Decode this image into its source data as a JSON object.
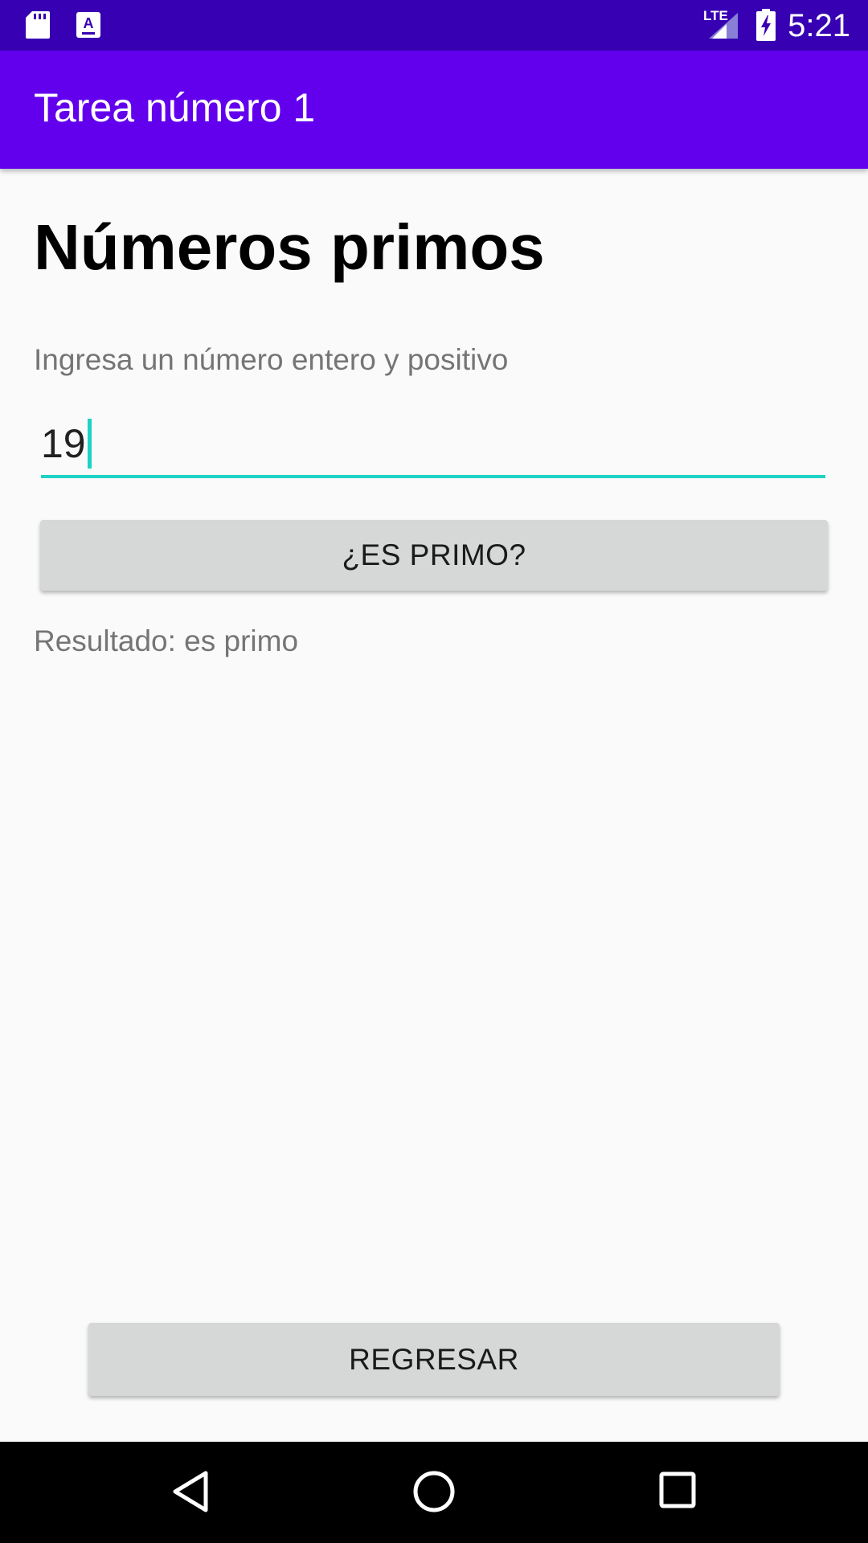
{
  "status_bar": {
    "time": "5:21",
    "network_label": "LTE",
    "left_icons": [
      "sd-card-icon",
      "keyboard-a-icon"
    ],
    "right_icons": [
      "signal-icon",
      "battery-charging-icon"
    ]
  },
  "app_bar": {
    "title": "Tarea número 1"
  },
  "main": {
    "heading": "Números primos",
    "prompt": "Ingresa un número entero y positivo",
    "number_input": {
      "value": "19"
    },
    "check_button_label": "¿ES PRIMO?",
    "result_text": "Resultado: es primo",
    "back_button_label": "REGRESAR"
  },
  "nav_bar": {
    "buttons": [
      "back-triangle-icon",
      "home-circle-icon",
      "recents-square-icon"
    ]
  },
  "colors": {
    "status_bar": "#3700b3",
    "app_bar": "#6200ee",
    "accent": "#1ed2c4",
    "button": "#d6d7d7",
    "background": "#fafafa"
  }
}
